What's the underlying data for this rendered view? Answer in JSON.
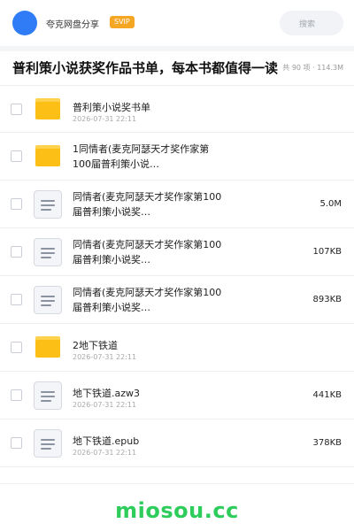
{
  "header": {
    "user_name": "夸克网盘分享",
    "badge": "SVIP",
    "search_placeholder": "搜索"
  },
  "page": {
    "title": "普利策小说获奖作品书单，每本书都值得一读",
    "meta": "共 90 项 · 114.3M"
  },
  "files": [
    {
      "type": "folder",
      "name": "普利策小说奖书单",
      "date": "2026-07-31 22:11",
      "size": ""
    },
    {
      "type": "folder",
      "name": "1同情者(麦克阿瑟天才奖作家第100届普利策小说…",
      "date": "2026-07-31 22:11",
      "size": ""
    },
    {
      "type": "file",
      "name": "同情者(麦克阿瑟天才奖作家第100届普利策小说奖…",
      "date": "2026-07-31 22:11",
      "size": "5.0M"
    },
    {
      "type": "file",
      "name": "同情者(麦克阿瑟天才奖作家第100届普利策小说奖…",
      "date": "2026-07-31 22:11",
      "size": "107KB"
    },
    {
      "type": "file",
      "name": "同情者(麦克阿瑟天才奖作家第100届普利策小说奖…",
      "date": "2026-07-31 22:11",
      "size": "893KB"
    },
    {
      "type": "folder",
      "name": "2地下铁道",
      "date": "2026-07-31 22:11",
      "size": ""
    },
    {
      "type": "file",
      "name": "地下铁道.azw3",
      "date": "2026-07-31 22:11",
      "size": "441KB"
    },
    {
      "type": "file",
      "name": "地下铁道.epub",
      "date": "2026-07-31 22:11",
      "size": "378KB"
    }
  ],
  "footer": {
    "watermark": "miosou.cc"
  },
  "colors": {
    "accent_blue": "#2f7cf6",
    "svip_orange": "#f5a623",
    "folder_yellow": "#fcbf16",
    "watermark_green": "#2ecc5b"
  }
}
